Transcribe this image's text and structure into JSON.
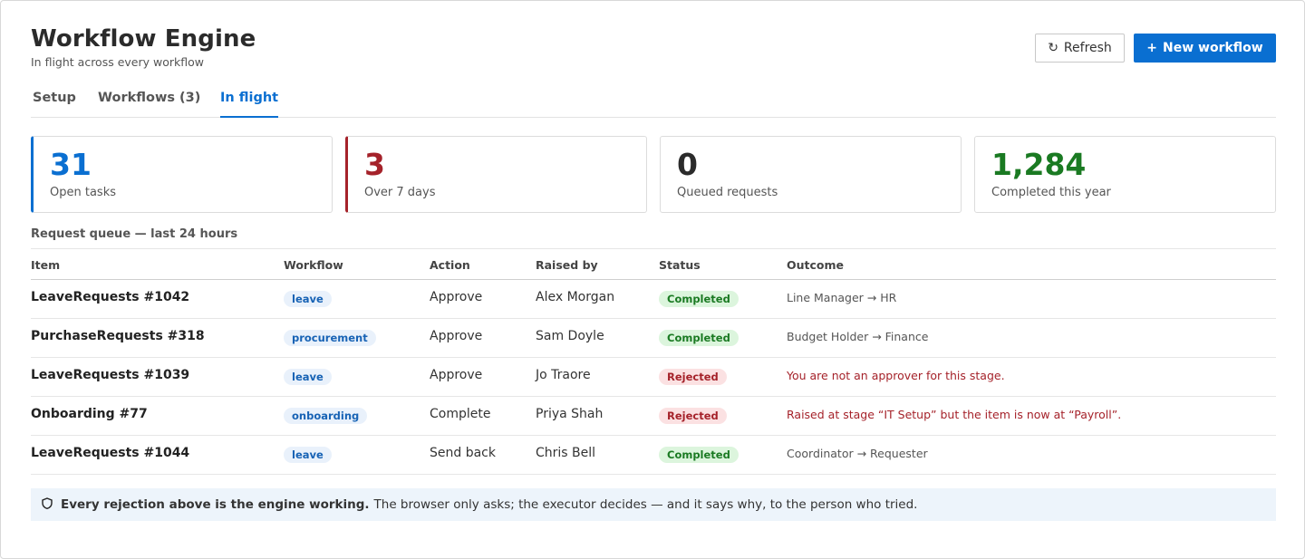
{
  "header": {
    "title": "Workflow Engine",
    "subtitle": "In flight across every workflow",
    "refresh_icon": "↻",
    "refresh_label": "Refresh",
    "new_icon": "+",
    "new_label": "New workflow"
  },
  "tabs": [
    {
      "label": "Setup",
      "active": false
    },
    {
      "label": "Workflows (3)",
      "active": false
    },
    {
      "label": "In flight",
      "active": true
    }
  ],
  "stats": [
    {
      "value": "31",
      "label": "Open tasks",
      "color": "#0a6fd1"
    },
    {
      "value": "3",
      "label": "Over 7 days",
      "color": "#a5222a"
    },
    {
      "value": "0",
      "label": "Queued requests",
      "color": "#2b2b2b"
    },
    {
      "value": "1,284",
      "label": "Completed this year",
      "color": "#1a7a22"
    }
  ],
  "queue": {
    "title": "Request queue — last 24 hours",
    "columns": [
      "Item",
      "Workflow",
      "Action",
      "Raised by",
      "Status",
      "Outcome"
    ],
    "rows": [
      {
        "item": "LeaveRequests #1042",
        "workflow": "leave",
        "action": "Approve",
        "raised_by": "Alex Morgan",
        "status": "Completed",
        "outcome": "Line Manager → HR"
      },
      {
        "item": "PurchaseRequests #318",
        "workflow": "procurement",
        "action": "Approve",
        "raised_by": "Sam Doyle",
        "status": "Completed",
        "outcome": "Budget Holder → Finance"
      },
      {
        "item": "LeaveRequests #1039",
        "workflow": "leave",
        "action": "Approve",
        "raised_by": "Jo Traore",
        "status": "Rejected",
        "outcome": "You are not an approver for this stage."
      },
      {
        "item": "Onboarding #77",
        "workflow": "onboarding",
        "action": "Complete",
        "raised_by": "Priya Shah",
        "status": "Rejected",
        "outcome": "Raised at stage “IT Setup” but the item is now at “Payroll”."
      },
      {
        "item": "LeaveRequests #1044",
        "workflow": "leave",
        "action": "Send back",
        "raised_by": "Chris Bell",
        "status": "Completed",
        "outcome": "Coordinator → Requester"
      }
    ]
  },
  "note": {
    "icon": "shield-icon",
    "bold": "Every rejection above is the engine working.",
    "text": "The browser only asks; the executor decides — and it says why, to the person who tried."
  }
}
